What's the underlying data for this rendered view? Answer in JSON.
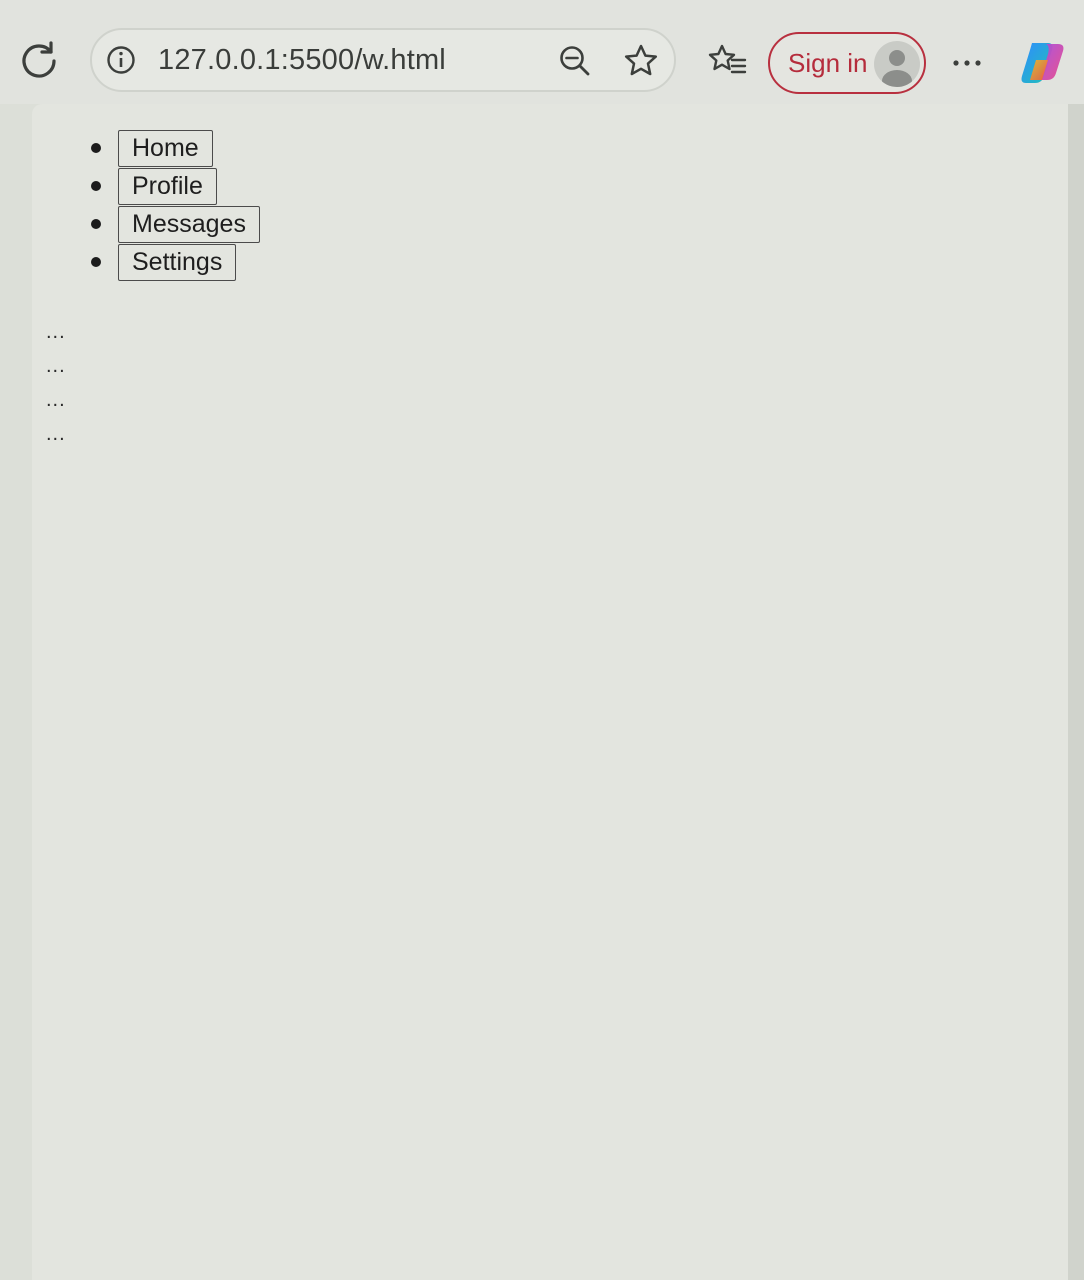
{
  "browser": {
    "url": "127.0.0.1:5500/w.html",
    "sign_in_label": "Sign in",
    "accent_color": "#b8303f"
  },
  "nav": {
    "items": [
      {
        "label": "Home"
      },
      {
        "label": "Profile"
      },
      {
        "label": "Messages"
      },
      {
        "label": "Settings"
      }
    ]
  },
  "ellipses": [
    "...",
    "...",
    "...",
    "..."
  ],
  "icons": [
    "reload-icon",
    "site-info-icon",
    "zoom-out-icon",
    "favorite-star-icon",
    "favorites-list-icon",
    "avatar-icon",
    "more-icon",
    "copilot-icon"
  ]
}
